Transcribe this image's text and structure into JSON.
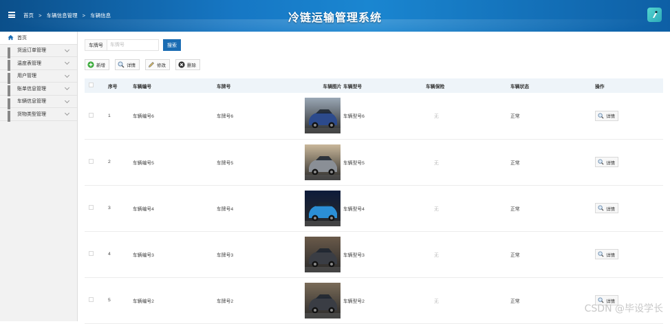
{
  "header": {
    "breadcrumb": [
      "首页",
      "车辆信息管理",
      "车辆信息"
    ],
    "breadcrumb_sep": ">",
    "title": "冷链运输管理系统"
  },
  "sidebar": {
    "items": [
      {
        "label": "首页",
        "icon": "home-icon"
      },
      {
        "label": "货运订单管理",
        "icon": "grid-icon"
      },
      {
        "label": "温度表管理",
        "icon": "grid-icon"
      },
      {
        "label": "用户管理",
        "icon": "grid-icon"
      },
      {
        "label": "账单信息管理",
        "icon": "grid-icon"
      },
      {
        "label": "车辆信息管理",
        "icon": "grid-icon"
      },
      {
        "label": "货物类型管理",
        "icon": "grid-icon"
      }
    ]
  },
  "search": {
    "label": "车牌号",
    "placeholder": "车牌号",
    "button": "搜索"
  },
  "toolbar": {
    "add": "新增",
    "detail": "详情",
    "edit": "修改",
    "delete": "删除"
  },
  "table": {
    "headers": [
      "序号",
      "车辆编号",
      "车牌号",
      "车辆图片",
      "车辆型号",
      "车辆保险",
      "车辆状态",
      "操作"
    ],
    "rows": [
      {
        "index": "1",
        "code": "车辆编号6",
        "plate": "车牌号6",
        "model": "车辆型号6",
        "insurance": "无",
        "status": "正常",
        "action": "详情",
        "car_color": "#2c4a8c",
        "bg": "#9aa7b5"
      },
      {
        "index": "2",
        "code": "车辆编号5",
        "plate": "车牌号5",
        "model": "车辆型号5",
        "insurance": "无",
        "status": "正常",
        "action": "详情",
        "car_color": "#8a8f96",
        "bg": "#c9b79a"
      },
      {
        "index": "3",
        "code": "车辆编号4",
        "plate": "车牌号4",
        "model": "车辆型号4",
        "insurance": "无",
        "status": "正常",
        "action": "详情",
        "car_color": "#2b8fd6",
        "bg": "#0d1b3a"
      },
      {
        "index": "4",
        "code": "车辆编号3",
        "plate": "车牌号3",
        "model": "车辆型号3",
        "insurance": "无",
        "status": "正常",
        "action": "详情",
        "car_color": "#3a3d44",
        "bg": "#6a5a4a"
      },
      {
        "index": "5",
        "code": "车辆编号2",
        "plate": "车牌号2",
        "model": "车辆型号2",
        "insurance": "无",
        "status": "正常",
        "action": "详情",
        "car_color": "#3a3d44",
        "bg": "#7a6b58"
      }
    ]
  },
  "watermark": "CSDN @毕设学长",
  "colors": {
    "accent": "#1a6cb3",
    "header": "#1677c4"
  }
}
